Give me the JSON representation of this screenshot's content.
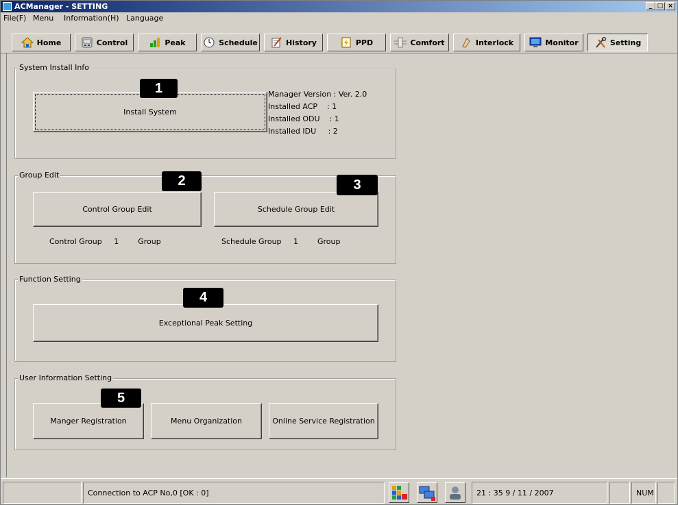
{
  "window": {
    "title": "ACManager - SETTING",
    "controls": {
      "minimize": "_",
      "maximize": "□",
      "close": "×"
    }
  },
  "menu": [
    "File(F)",
    "Menu",
    "Information(H)",
    "Language"
  ],
  "toolbar": [
    {
      "label": "Home",
      "icon": "home-icon"
    },
    {
      "label": "Control",
      "icon": "control-icon"
    },
    {
      "label": "Peak",
      "icon": "peak-icon"
    },
    {
      "label": "Schedule",
      "icon": "clock-icon"
    },
    {
      "label": "History",
      "icon": "history-icon"
    },
    {
      "label": "PPD",
      "icon": "ppd-icon"
    },
    {
      "label": "Comfort",
      "icon": "comfort-icon"
    },
    {
      "label": "Interlock",
      "icon": "interlock-icon"
    },
    {
      "label": "Monitor",
      "icon": "monitor-icon"
    },
    {
      "label": "Setting",
      "icon": "setting-icon",
      "active": true
    }
  ],
  "system_install": {
    "legend": "System Install Info",
    "badge": "1",
    "button": "Install System",
    "info": "Manager Version : Ver. 2.0\nInstalled ACP    : 1\nInstalled ODU    : 1\nInstalled IDU     : 2"
  },
  "group_edit": {
    "legend": "Group Edit",
    "badge_control": "2",
    "badge_schedule": "3",
    "control_button": "Control Group Edit",
    "schedule_button": "Schedule Group Edit",
    "control_count": "Control Group     1        Group",
    "schedule_count": "Schedule Group     1        Group"
  },
  "function_setting": {
    "legend": "Function Setting",
    "badge": "4",
    "button": "Exceptional Peak Setting"
  },
  "user_info": {
    "legend": "User Information Setting",
    "badge": "5",
    "buttons": [
      "Manger Registration",
      "Menu Organization",
      "Online Service Registration"
    ]
  },
  "status": {
    "connection": "Connection to ACP No,0 [OK : 0]",
    "time": "21 : 35     9 / 11 / 2007",
    "num": "NUM",
    "icons": [
      "status-grid-icon",
      "network-icon",
      "user-icon"
    ]
  }
}
